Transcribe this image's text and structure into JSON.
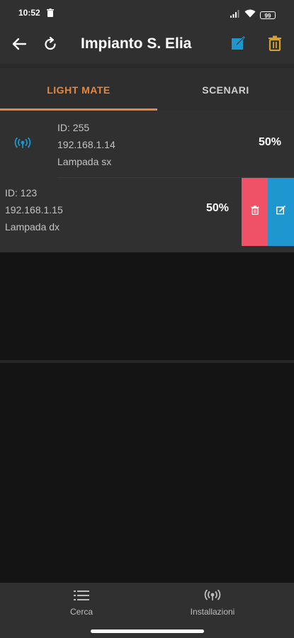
{
  "status": {
    "time": "10:52",
    "battery": "99"
  },
  "appbar": {
    "title": "Impianto S. Elia"
  },
  "tabs": [
    {
      "label": "LIGHT MATE",
      "active": true
    },
    {
      "label": "SCENARI",
      "active": false
    }
  ],
  "devices": [
    {
      "id": "ID: 255",
      "ip": "192.168.1.14",
      "name": "Lampada sx",
      "level": "50%"
    },
    {
      "id": "ID: 123",
      "ip": "192.168.1.15",
      "name": "Lampada dx",
      "level": "50%"
    }
  ],
  "bottom_nav": [
    {
      "label": "Cerca",
      "icon": "list-icon"
    },
    {
      "label": "Installazioni",
      "icon": "antenna-icon"
    }
  ],
  "colors": {
    "accent": "#e8873c",
    "edit_blue": "#1e96cf",
    "delete_red": "#ef5167",
    "trash_yellow": "#d4a22a"
  }
}
